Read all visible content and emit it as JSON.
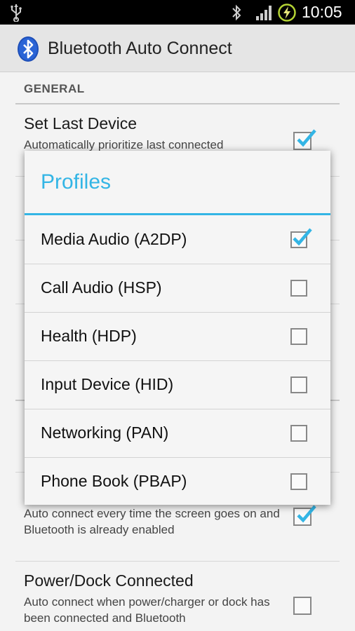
{
  "status_bar": {
    "time": "10:05",
    "icons": [
      "usb-icon",
      "bluetooth-icon",
      "signal-icon",
      "battery-charging-icon"
    ]
  },
  "app": {
    "title": "Bluetooth Auto Connect",
    "icon": "bluetooth-icon"
  },
  "preferences": {
    "section_general": "GENERAL",
    "set_last_device_title": "Set Last Device",
    "set_last_device_summary": "Automatically prioritize last connected",
    "screen_on_summary": "Auto connect every time the screen goes on and Bluetooth is already enabled",
    "power_dock_title": "Power/Dock Connected",
    "power_dock_summary": "Auto connect when power/charger or dock has been connected and Bluetooth"
  },
  "dialog": {
    "title": "Profiles",
    "items": [
      {
        "label": "Media Audio (A2DP)",
        "checked": true
      },
      {
        "label": "Call Audio (HSP)",
        "checked": false
      },
      {
        "label": "Health (HDP)",
        "checked": false
      },
      {
        "label": "Input Device (HID)",
        "checked": false
      },
      {
        "label": "Networking (PAN)",
        "checked": false
      },
      {
        "label": "Phone Book (PBAP)",
        "checked": false
      }
    ]
  },
  "colors": {
    "accent": "#33b5e5",
    "check": "#33b5e5"
  }
}
